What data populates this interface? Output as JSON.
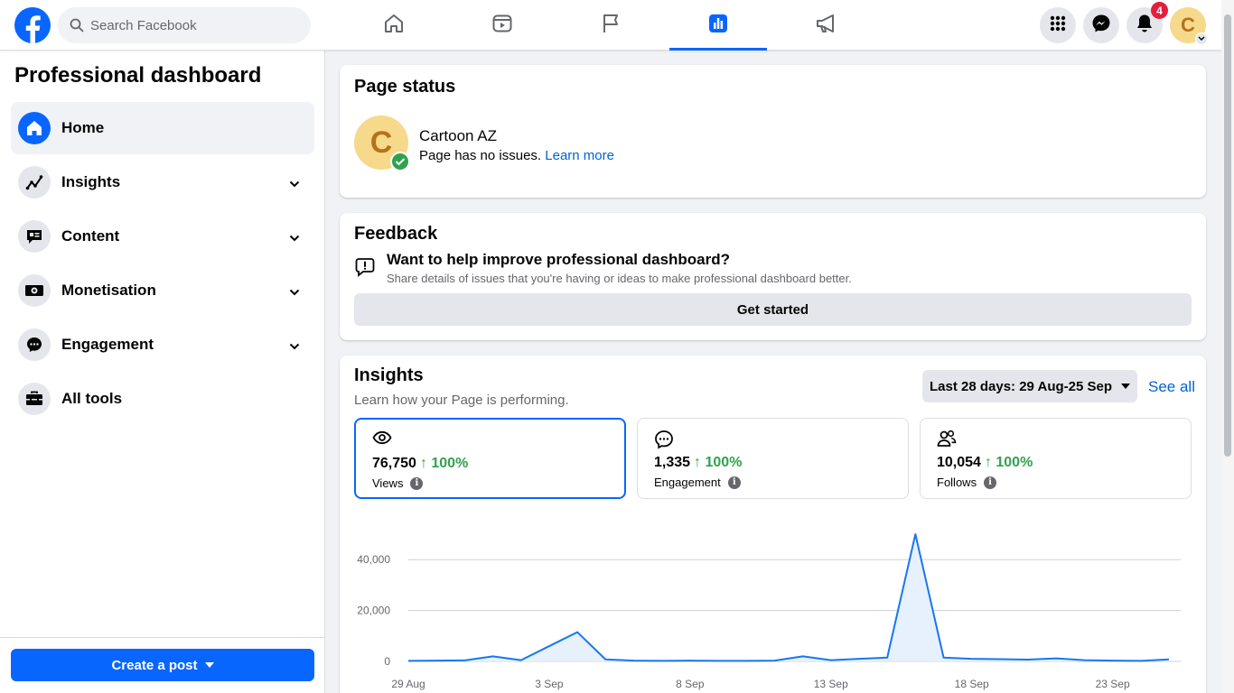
{
  "header": {
    "search_placeholder": "Search Facebook",
    "nav_tabs": [
      "home-icon",
      "video-icon",
      "flag-icon",
      "dashboard-icon",
      "megaphone-icon"
    ],
    "active_tab": "dashboard-icon",
    "notification_count": "4",
    "profile_initial": "C"
  },
  "sidebar": {
    "title": "Professional dashboard",
    "items": [
      {
        "label": "Home",
        "icon": "home-icon",
        "active": true
      },
      {
        "label": "Insights",
        "icon": "insights-icon"
      },
      {
        "label": "Content",
        "icon": "content-icon"
      },
      {
        "label": "Monetisation",
        "icon": "money-icon"
      },
      {
        "label": "Engagement",
        "icon": "engagement-icon"
      },
      {
        "label": "All tools",
        "icon": "toolbox-icon"
      }
    ],
    "create_post_label": "Create a post"
  },
  "page_status": {
    "title": "Page status",
    "avatar_initial": "C",
    "page_name": "Cartoon AZ",
    "status_text": "Page has no issues.",
    "learn_more": "Learn more"
  },
  "feedback": {
    "title": "Feedback",
    "question": "Want to help improve professional dashboard?",
    "description": "Share details of issues that you're having or ideas to make professional dashboard better.",
    "button_label": "Get started"
  },
  "insights": {
    "title": "Insights",
    "subtitle": "Learn how your Page is performing.",
    "date_range": "Last 28 days: 29 Aug-25 Sep",
    "see_all": "See all",
    "metrics": [
      {
        "value": "76,750",
        "change": "↑ 100%",
        "label": "Views",
        "icon": "eye-icon",
        "active": true
      },
      {
        "value": "1,335",
        "change": "↑ 100%",
        "label": "Engagement",
        "icon": "chat-icon"
      },
      {
        "value": "10,054",
        "change": "↑ 100%",
        "label": "Follows",
        "icon": "people-icon"
      }
    ]
  },
  "chart_data": {
    "type": "area",
    "x": [
      "29 Aug",
      "30 Aug",
      "31 Aug",
      "1 Sep",
      "2 Sep",
      "3 Sep",
      "4 Sep",
      "5 Sep",
      "6 Sep",
      "7 Sep",
      "8 Sep",
      "9 Sep",
      "10 Sep",
      "11 Sep",
      "12 Sep",
      "13 Sep",
      "14 Sep",
      "15 Sep",
      "16 Sep",
      "17 Sep",
      "18 Sep",
      "19 Sep",
      "20 Sep",
      "21 Sep",
      "22 Sep",
      "23 Sep",
      "24 Sep",
      "25 Sep"
    ],
    "series": [
      {
        "values": [
          200,
          300,
          400,
          2000,
          500,
          6000,
          11500,
          800,
          300,
          200,
          300,
          200,
          200,
          300,
          2000,
          500,
          1000,
          1500,
          50000,
          1500,
          1000,
          900,
          700,
          1200,
          500,
          300,
          200,
          800
        ]
      }
    ],
    "x_tick_labels": [
      "29 Aug",
      "3 Sep",
      "8 Sep",
      "13 Sep",
      "18 Sep",
      "23 Sep"
    ],
    "y_tick_labels": [
      "0",
      "20,000",
      "40,000"
    ],
    "ylim": [
      0,
      50000
    ],
    "grid": true,
    "colors": {
      "line": "#1877f2",
      "fill": "#e7f0fd"
    }
  }
}
